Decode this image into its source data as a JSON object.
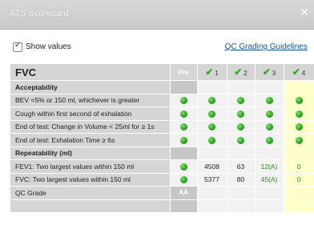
{
  "window": {
    "title": "ATS Scorecard"
  },
  "toolbar": {
    "show_values_label": "Show values",
    "show_values_checked": true,
    "guidelines_link": "QC Grading Guidelines"
  },
  "table": {
    "heading": "FVC",
    "pre_label": "Pre",
    "columns": [
      {
        "check": "✔",
        "num": "1"
      },
      {
        "check": "✔",
        "num": "2"
      },
      {
        "check": "✔",
        "num": "3"
      },
      {
        "check": "✔",
        "num": "4"
      }
    ],
    "sections": {
      "acceptability": "Acceptability",
      "repeatability": "Repeatability (ml)",
      "qc_grade": "QC Grade"
    },
    "acceptability_rows": [
      "BEV <5% or 150 ml, whichever is greater",
      "Cough within first second of exhalation",
      "End of test: Change in Volume < 25ml for ≥ 1s",
      "End of test: Exhalation Time ≥ 6s"
    ],
    "repeatability_rows": [
      {
        "label": "FEV1: Two largest values within 150 ml",
        "values": [
          "4508",
          "63",
          "12(A)",
          "0"
        ]
      },
      {
        "label": "FVC: Two largest values within 150 ml",
        "values": [
          "5377",
          "80",
          "45(A)",
          "0"
        ]
      }
    ],
    "qc_grade_value": "AA",
    "indicator_color": "#2fa520"
  }
}
